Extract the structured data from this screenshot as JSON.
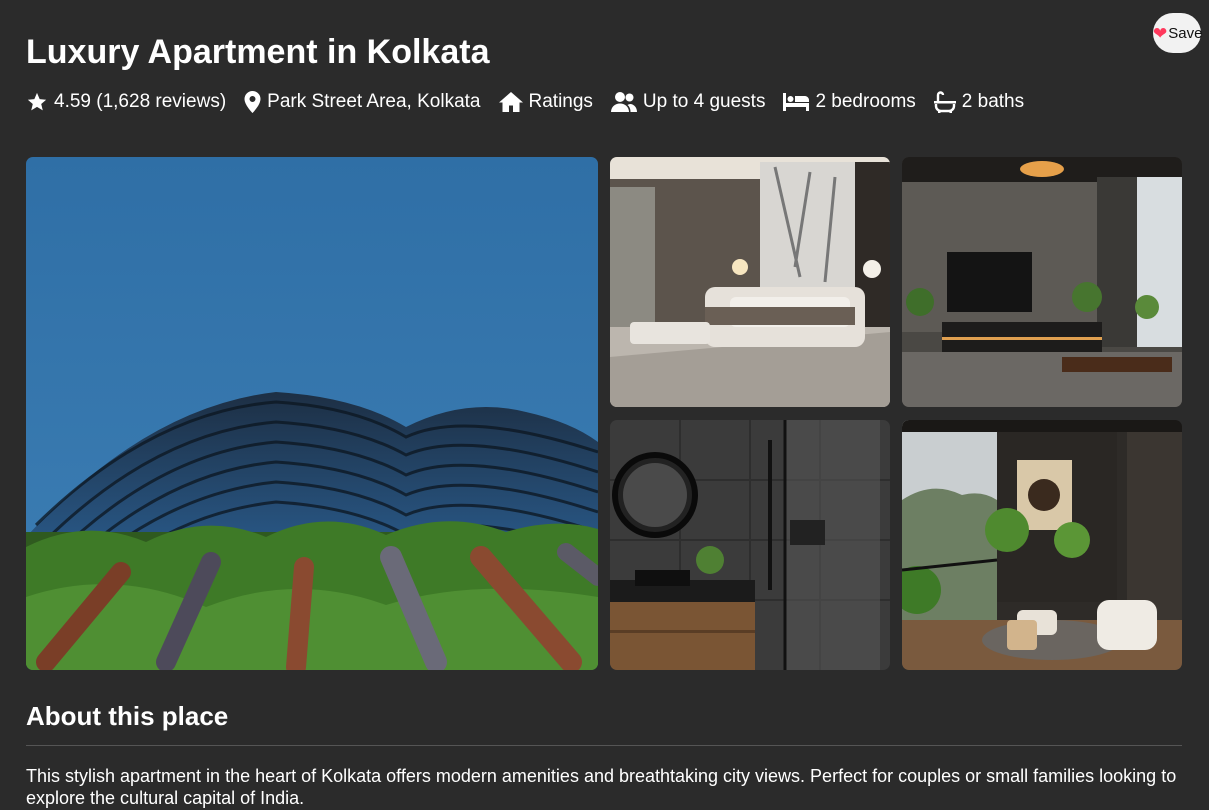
{
  "listing": {
    "title": "Luxury Apartment in Kolkata",
    "save_label": "Save",
    "meta": {
      "rating": "4.59 (1,628 reviews)",
      "location": "Park Street Area, Kolkata",
      "ratings_link": "Ratings",
      "guests": "Up to 4 guests",
      "bedrooms": "2 bedrooms",
      "baths": "2 baths"
    },
    "photos": [
      {
        "name": "tower-exterior-photo",
        "subject": "curved glass high-rise with green pipes and plants"
      },
      {
        "name": "bedroom-photo",
        "subject": "marble wall bedroom with large bed"
      },
      {
        "name": "living-room-photo",
        "subject": "dark living room with wall TV"
      },
      {
        "name": "bathroom-photo",
        "subject": "dark tiled bathroom with round mirror and shower"
      },
      {
        "name": "balcony-photo",
        "subject": "balcony lounge with armchairs and plants"
      }
    ]
  },
  "about": {
    "heading": "About this place",
    "description": "This stylish apartment in the heart of Kolkata offers modern amenities and breathtaking city views. Perfect for couples or small families looking to explore the cultural capital of India."
  },
  "colors": {
    "background": "#2b2b2b",
    "text": "#ffffff",
    "accent_heart": "#ff385c"
  }
}
